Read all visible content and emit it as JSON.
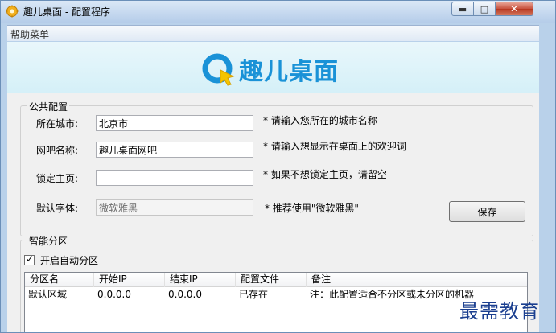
{
  "window": {
    "title": "趣儿桌面 - 配置程序",
    "controls": {
      "minimize": "▬",
      "maximize": "□",
      "close": "✕"
    }
  },
  "menu": {
    "help": "帮助菜单"
  },
  "banner": {
    "logo_text": "趣儿桌面",
    "logo_color": "#1a92d7"
  },
  "public_config": {
    "title": "公共配置",
    "city": {
      "label": "所在城市:",
      "value": "北京市",
      "hint": "* 请输入您所在的城市名称"
    },
    "cafe_name": {
      "label": "网吧名称:",
      "value": "趣儿桌面网吧",
      "hint": "* 请输入想显示在桌面上的欢迎词"
    },
    "homepage": {
      "label": "锁定主页:",
      "value": "",
      "hint": "* 如果不想锁定主页，请留空"
    },
    "font": {
      "label": "默认字体:",
      "value": "微软雅黑",
      "hint": "* 推荐使用\"微软雅黑\""
    },
    "save_label": "保存"
  },
  "smart_partition": {
    "title": "智能分区",
    "auto_partition_label": "开启自动分区",
    "auto_partition_checked": true,
    "columns": [
      "分区名",
      "开始IP",
      "结束IP",
      "配置文件",
      "备注"
    ],
    "rows": [
      {
        "name": "默认区域",
        "start_ip": "0.0.0.0",
        "end_ip": "0.0.0.0",
        "config": "已存在",
        "note": "注：此配置适合不分区或未分区的机器"
      }
    ]
  },
  "watermark": "最需教育"
}
